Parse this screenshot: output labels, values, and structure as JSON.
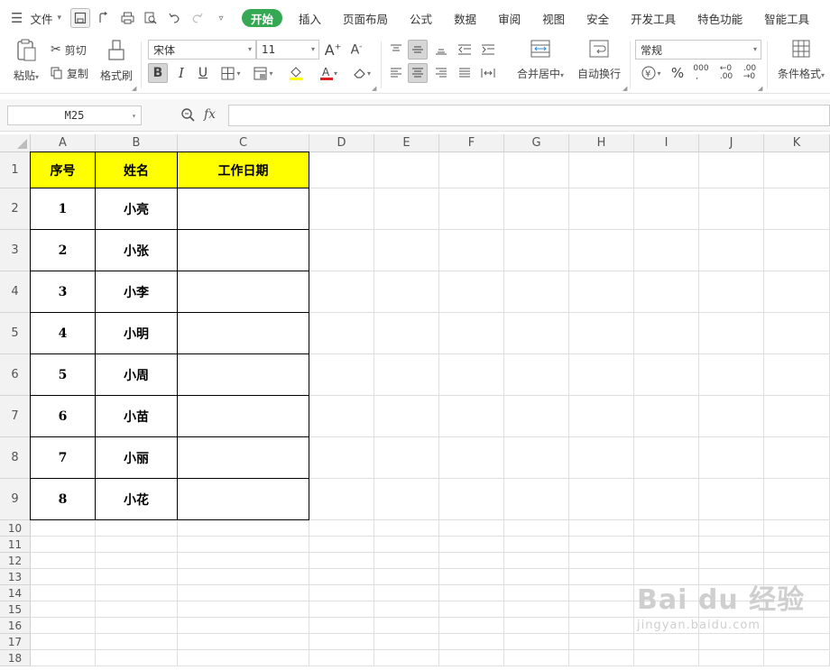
{
  "menubar": {
    "file": "文件",
    "tabs": [
      "开始",
      "插入",
      "页面布局",
      "公式",
      "数据",
      "审阅",
      "视图",
      "安全",
      "开发工具",
      "特色功能",
      "智能工具箱"
    ]
  },
  "ribbon": {
    "paste": "粘贴",
    "cut": "剪切",
    "copy": "复制",
    "format_painter": "格式刷",
    "font_name": "宋体",
    "font_size": "11",
    "merge_center": "合并居中",
    "wrap_text": "自动换行",
    "number_format": "常规",
    "conditional_format": "条件格式"
  },
  "formula_bar": {
    "name_box": "M25",
    "fx_label": "fx",
    "formula": ""
  },
  "sheet": {
    "columns": [
      "A",
      "B",
      "C",
      "D",
      "E",
      "F",
      "G",
      "H",
      "I",
      "J",
      "K"
    ],
    "rows": [
      "1",
      "2",
      "3",
      "4",
      "5",
      "6",
      "7",
      "8",
      "9",
      "10",
      "11",
      "12",
      "13",
      "14",
      "15",
      "16",
      "17",
      "18"
    ],
    "table": {
      "headers": [
        "序号",
        "姓名",
        "工作日期"
      ],
      "header_fill": "#ffff00",
      "rows": [
        [
          "1",
          "小亮",
          ""
        ],
        [
          "2",
          "小张",
          ""
        ],
        [
          "3",
          "小李",
          ""
        ],
        [
          "4",
          "小明",
          ""
        ],
        [
          "5",
          "小周",
          ""
        ],
        [
          "6",
          "小苗",
          ""
        ],
        [
          "7",
          "小丽",
          ""
        ],
        [
          "8",
          "小花",
          ""
        ]
      ]
    }
  },
  "watermark": {
    "brand": "Bai du 经验",
    "url": "jingyan.baidu.com"
  },
  "colors": {
    "active_tab": "#34a853",
    "grid": "#dedede",
    "header_bg": "#f2f2f2"
  }
}
